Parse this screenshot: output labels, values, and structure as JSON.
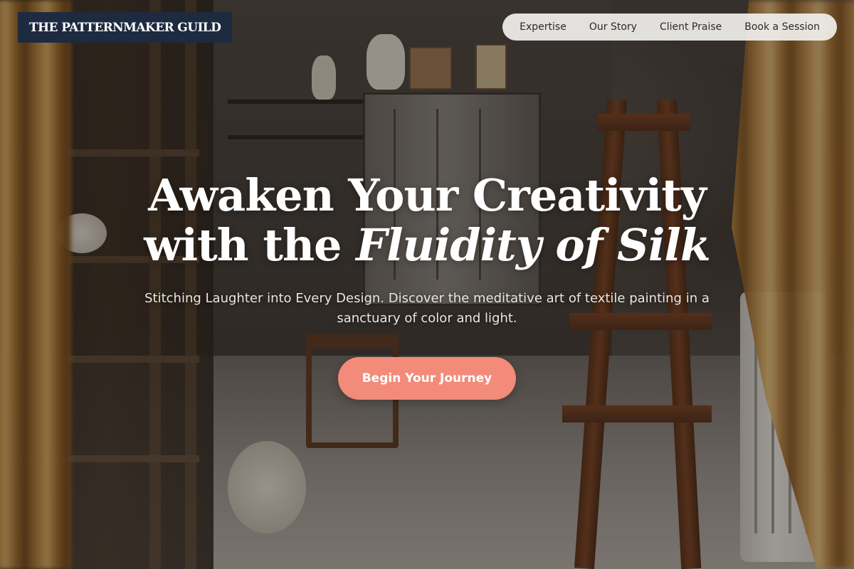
{
  "brand": {
    "name": "THE PATTERNMAKER GUILD"
  },
  "nav": {
    "items": [
      {
        "label": "Expertise"
      },
      {
        "label": "Our Story"
      },
      {
        "label": "Client Praise"
      },
      {
        "label": "Book a Session"
      }
    ]
  },
  "hero": {
    "title_line1": "Awaken Your Creativity",
    "title_line2_prefix": "with the ",
    "title_line2_emphasis": "Fluidity of Silk",
    "subtitle": "Stitching Laughter into Every Design. Discover the meditative art of textile painting in a sanctuary of color and light.",
    "cta_label": "Begin Your Journey"
  },
  "colors": {
    "brand_bg": "#1e2a40",
    "cta_bg": "#f28b7a",
    "nav_bg": "#f0eeeb"
  },
  "icons": {
    "background_image": "artist-studio-photo"
  }
}
